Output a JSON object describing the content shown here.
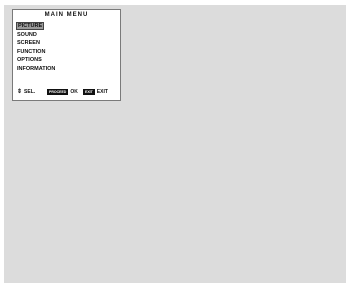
{
  "menu": {
    "title": "MAIN MENU",
    "items": [
      {
        "label": "PICTURE",
        "selected": true
      },
      {
        "label": "SOUND",
        "selected": false
      },
      {
        "label": "SCREEN",
        "selected": false
      },
      {
        "label": "FUNCTION",
        "selected": false
      },
      {
        "label": "OPTIONS",
        "selected": false
      },
      {
        "label": "INFORMATION",
        "selected": false
      }
    ]
  },
  "footer": {
    "select_icon": "up-down-arrow-icon",
    "select_label": "SEL.",
    "ok_key": "PROCEED",
    "ok_label": "OK",
    "exit_key": "EXIT",
    "exit_label": "EXIT"
  },
  "colors": {
    "screen_background": "#dcdcdc",
    "menu_background": "#ffffff",
    "selection_highlight": "#9a9a9a",
    "key_box": "#111111"
  }
}
